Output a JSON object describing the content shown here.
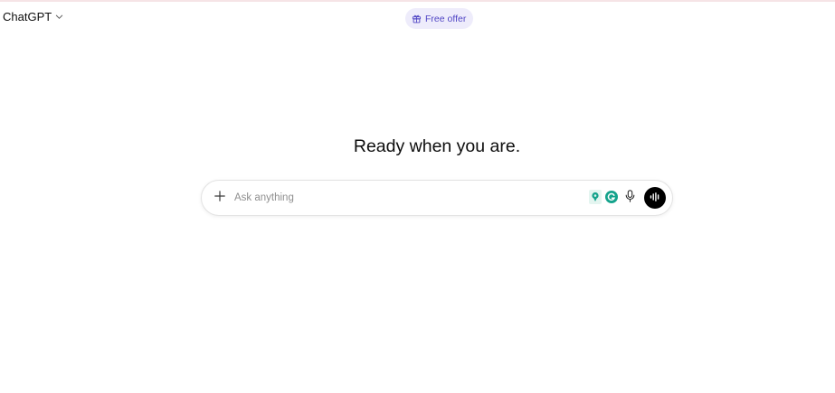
{
  "header": {
    "model_label": "ChatGPT",
    "model_chevron_icon": "chevron-down-icon",
    "offer_label": "Free offer",
    "offer_icon": "gift-icon"
  },
  "main": {
    "headline": "Ready when you are."
  },
  "composer": {
    "placeholder": "Ask anything",
    "value": "",
    "plus_icon": "plus-icon",
    "extension_icons": [
      "pin-extension-icon",
      "grammarly-icon"
    ],
    "mic_icon": "microphone-icon",
    "voice_icon": "voice-mode-icon"
  },
  "colors": {
    "offer_bg": "#eeecfb",
    "offer_text": "#5146c5",
    "extension_green": "#15a38c",
    "voice_button": "#000000",
    "top_border": "#f6e4e6"
  }
}
